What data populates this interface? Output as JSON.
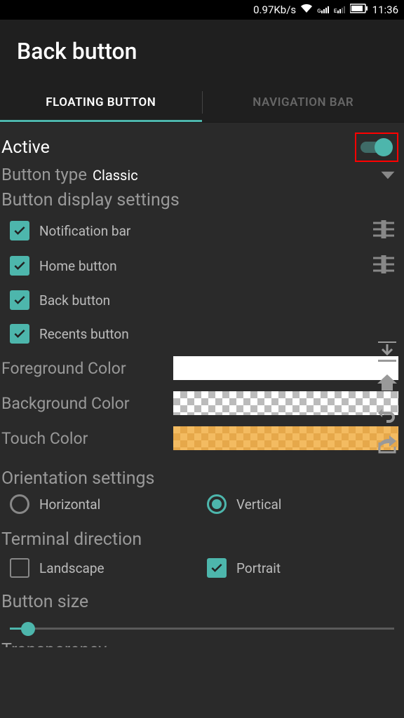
{
  "statusBar": {
    "speed": "0.97Kb/s",
    "time": "11:36"
  },
  "header": {
    "title": "Back button"
  },
  "tabs": {
    "floating": "FLOATING BUTTON",
    "navigation": "NAVIGATION BAR"
  },
  "active": {
    "label": "Active"
  },
  "buttonType": {
    "label": "Button type",
    "value": "Classic"
  },
  "displaySettings": {
    "title": "Button display settings",
    "items": [
      {
        "label": "Notification bar",
        "checked": true
      },
      {
        "label": "Home button",
        "checked": true
      },
      {
        "label": "Back button",
        "checked": true
      },
      {
        "label": "Recents button",
        "checked": true
      }
    ]
  },
  "colors": {
    "foreground": "Foreground Color",
    "background": "Background Color",
    "touch": "Touch Color"
  },
  "orientation": {
    "title": "Orientation settings",
    "horizontal": "Horizontal",
    "vertical": "Vertical"
  },
  "terminal": {
    "title": "Terminal direction",
    "landscape": "Landscape",
    "portrait": "Portrait"
  },
  "buttonSize": {
    "title": "Button size"
  },
  "transparency": {
    "title": "Transparency"
  }
}
